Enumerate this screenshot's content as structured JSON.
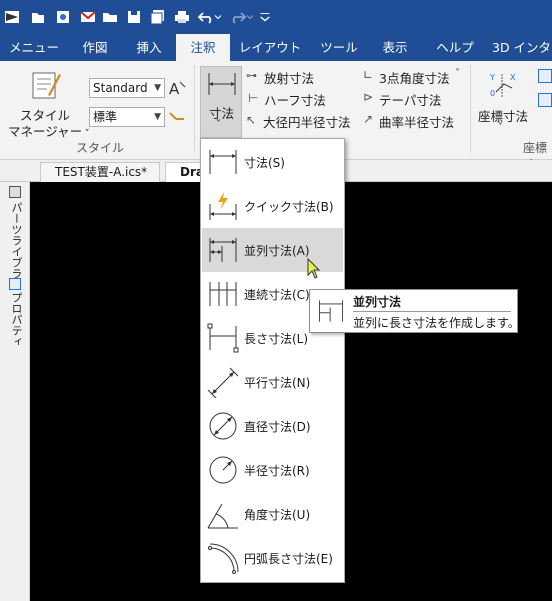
{
  "ribbon_tabs": [
    "メニュー",
    "作図",
    "挿入",
    "注釈",
    "レイアウト",
    "ツール",
    "表示",
    "ヘルプ",
    "3D インター"
  ],
  "active_tab": "注釈",
  "style_group": {
    "style_manager_line1": "スタイル",
    "style_manager_line2": "マネージャー",
    "combo_standard": "Standard",
    "combo_hyojun": "標準",
    "group_label": "スタイル"
  },
  "dimension_group": {
    "dim_button_label": "寸法",
    "radial_dim": "放射寸法",
    "half_dim": "ハーフ寸法",
    "large_radius_dim": "大径円半径寸法",
    "three_point_angle": "3点角度寸法",
    "taper_dim": "テーパ寸法",
    "curvature_radius": "曲率半径寸法"
  },
  "coord_group": {
    "coord_dim_label": "座標寸法",
    "group_label_partial": "座標寸"
  },
  "doc_tabs": [
    "TEST装置-A.ics*",
    "Dra"
  ],
  "side_panel": {
    "parts_library": "パーツライブラリ",
    "properties": "プロパティ"
  },
  "menu_items": [
    {
      "label": "寸法(S)",
      "icon": "linear-dimension-icon"
    },
    {
      "label": "クイック寸法(B)",
      "icon": "quick-dimension-icon"
    },
    {
      "label": "並列寸法(A)",
      "icon": "parallel-dimension-icon"
    },
    {
      "label": "連続寸法(C)",
      "icon": "continuous-dimension-icon"
    },
    {
      "label": "長さ寸法(L)",
      "icon": "length-dimension-icon"
    },
    {
      "label": "平行寸法(N)",
      "icon": "aligned-dimension-icon"
    },
    {
      "label": "直径寸法(D)",
      "icon": "diameter-dimension-icon"
    },
    {
      "label": "半径寸法(R)",
      "icon": "radius-dimension-icon"
    },
    {
      "label": "角度寸法(U)",
      "icon": "angle-dimension-icon"
    },
    {
      "label": "円弧長さ寸法(E)",
      "icon": "arc-length-dimension-icon"
    }
  ],
  "highlighted_menu_item": "並列寸法(A)",
  "tooltip": {
    "title": "並列寸法",
    "description": "並列に長さ寸法を作成します。"
  },
  "colors": {
    "title_bar": "#1f4e96",
    "ribbon_bg": "#f3f3f3",
    "canvas_bg": "#000000",
    "highlight": "#d9d9d9"
  }
}
